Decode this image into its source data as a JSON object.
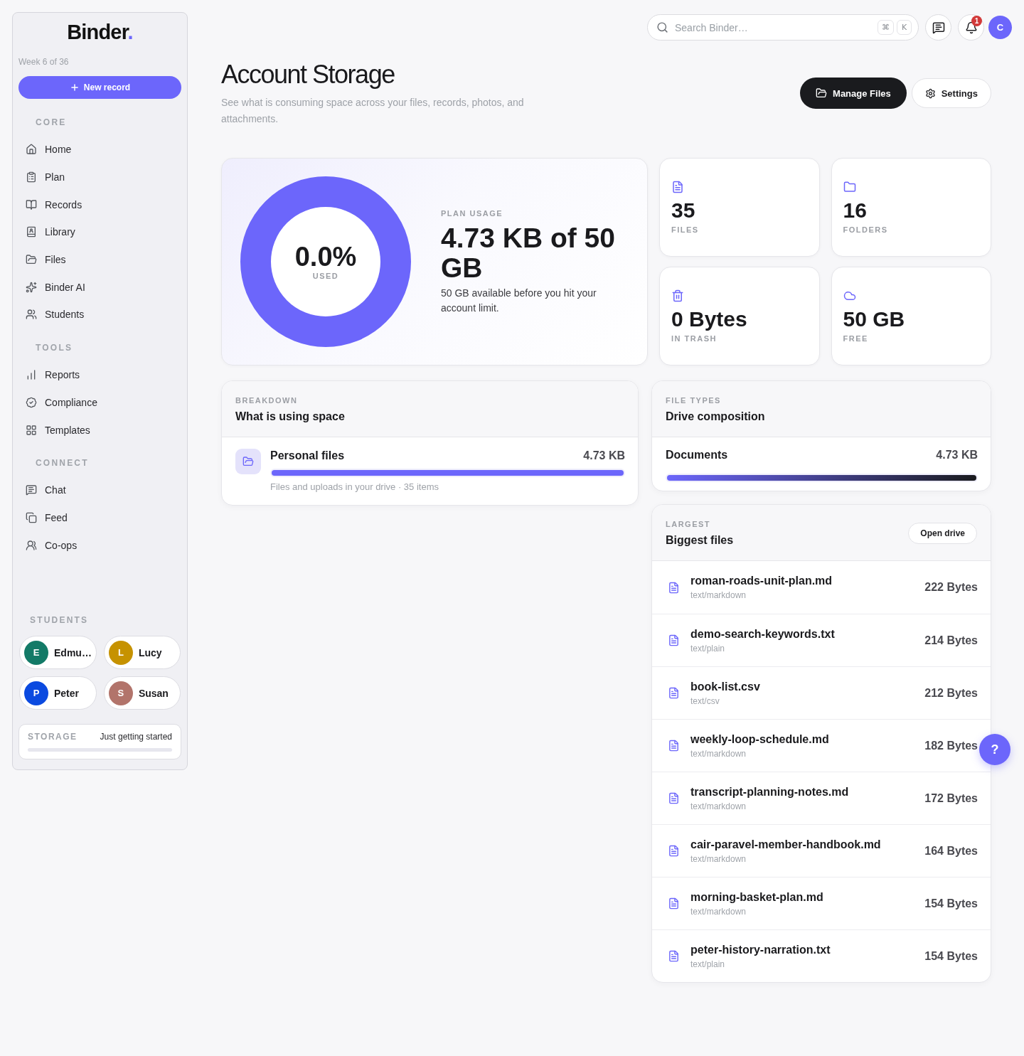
{
  "sidebar": {
    "logo": {
      "text": "Binder",
      "dot": "."
    },
    "week": "Week 6 of 36",
    "new_record": "New record",
    "sections": [
      {
        "title": "CORE",
        "items": [
          {
            "label": "Home"
          },
          {
            "label": "Plan"
          },
          {
            "label": "Records"
          },
          {
            "label": "Library"
          },
          {
            "label": "Files"
          },
          {
            "label": "Binder AI"
          },
          {
            "label": "Students"
          }
        ]
      },
      {
        "title": "TOOLS",
        "items": [
          {
            "label": "Reports"
          },
          {
            "label": "Compliance"
          },
          {
            "label": "Templates"
          }
        ]
      },
      {
        "title": "CONNECT",
        "items": [
          {
            "label": "Chat"
          },
          {
            "label": "Feed"
          },
          {
            "label": "Co-ops"
          }
        ]
      }
    ],
    "students": {
      "title": "STUDENTS",
      "items": [
        {
          "initial": "E",
          "name": "Edmu…",
          "color": "#137a67"
        },
        {
          "initial": "L",
          "name": "Lucy",
          "color": "#c69200"
        },
        {
          "initial": "P",
          "name": "Peter",
          "color": "#0b4ae0"
        },
        {
          "initial": "S",
          "name": "Susan",
          "color": "#b2746b"
        }
      ]
    },
    "storage": {
      "label": "STORAGE",
      "status": "Just getting started"
    }
  },
  "topbar": {
    "search": {
      "placeholder": "Search Binder…",
      "shortcut": [
        "⌘",
        "K"
      ]
    },
    "notifications": "1",
    "avatar": "C"
  },
  "header": {
    "title": "Account Storage",
    "subtitle": "See what is consuming space across your files, records, photos, and attachments.",
    "actions": [
      {
        "label": "Manage Files",
        "kind": "primary"
      },
      {
        "label": "Settings",
        "kind": "secondary"
      }
    ]
  },
  "usage": {
    "percent": "0.0%",
    "percent_label": "USED",
    "eyebrow": "PLAN USAGE",
    "amount": "4.73 KB of 50 GB",
    "note": "50 GB available before you hit your account limit."
  },
  "stats": [
    {
      "value": "35",
      "label": "FILES"
    },
    {
      "value": "16",
      "label": "FOLDERS"
    },
    {
      "value": "0 Bytes",
      "label": "IN TRASH"
    },
    {
      "value": "50 GB",
      "label": "FREE"
    }
  ],
  "breakdown": {
    "eyebrow": "BREAKDOWN",
    "title": "What is using space",
    "items": [
      {
        "name": "Personal files",
        "size": "4.73 KB",
        "level": 1,
        "caption": "Files and uploads in your drive · 35 items"
      }
    ]
  },
  "file_types": {
    "eyebrow": "FILE TYPES",
    "title": "Drive composition",
    "items": [
      {
        "name": "Documents",
        "size": "4.73 KB",
        "level": 1
      }
    ]
  },
  "largest": {
    "eyebrow": "LARGEST",
    "title": "Biggest files",
    "action": "Open drive",
    "files": [
      {
        "name": "roman-roads-unit-plan.md",
        "mime": "text/markdown",
        "size": "222 Bytes"
      },
      {
        "name": "demo-search-keywords.txt",
        "mime": "text/plain",
        "size": "214 Bytes"
      },
      {
        "name": "book-list.csv",
        "mime": "text/csv",
        "size": "212 Bytes"
      },
      {
        "name": "weekly-loop-schedule.md",
        "mime": "text/markdown",
        "size": "182 Bytes"
      },
      {
        "name": "transcript-planning-notes.md",
        "mime": "text/markdown",
        "size": "172 Bytes"
      },
      {
        "name": "cair-paravel-member-handbook.md",
        "mime": "text/markdown",
        "size": "164 Bytes"
      },
      {
        "name": "morning-basket-plan.md",
        "mime": "text/markdown",
        "size": "154 Bytes"
      },
      {
        "name": "peter-history-narration.txt",
        "mime": "text/plain",
        "size": "154 Bytes"
      }
    ]
  },
  "help": "?"
}
